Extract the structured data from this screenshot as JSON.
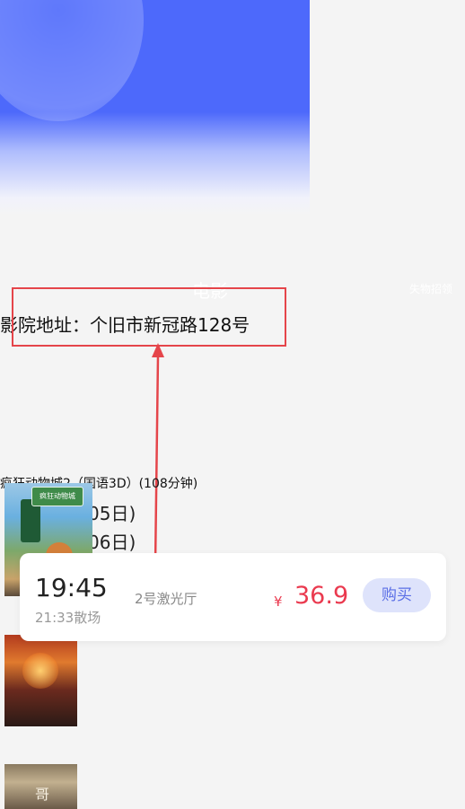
{
  "nav": {
    "back_icon": "chevron-left-icon",
    "back_glyph": "‹",
    "title": "电影",
    "right_label": "失物招领"
  },
  "cinema": {
    "address": "影院地址：个旧市新冠路128号"
  },
  "movie": {
    "title": "疯狂动物城2（国语3D）(108分钟)",
    "dates": [
      "05日)",
      "06日)"
    ]
  },
  "showtime": {
    "start": "19:45",
    "end": "21:33散场",
    "hall": "2号激光厅",
    "currency": "¥",
    "price": "36.9",
    "buy_label": "购买"
  },
  "posters": [
    {
      "name": "zootopia-2-poster",
      "sign_text": "疯狂动物城"
    },
    {
      "name": "avatar-poster"
    },
    {
      "name": "third-movie-poster",
      "glyph": "哥"
    }
  ],
  "colors": {
    "hero_blue": "#4d69fb",
    "price_red": "#ea3a4f",
    "annotation_red": "#e5454a",
    "buy_bg": "#dee3fb",
    "buy_text": "#5b6fe6"
  }
}
